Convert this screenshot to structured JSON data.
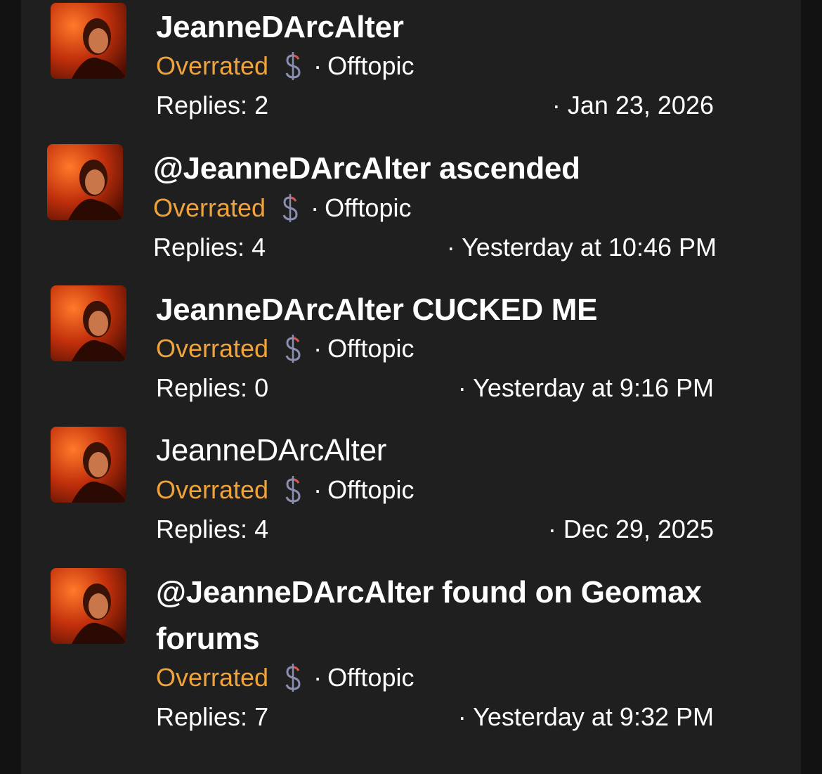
{
  "threads": [
    {
      "title": "JeanneDArcAlter",
      "prefix": "Overrated",
      "separator": "·",
      "forum": "Offtopic",
      "replies": "Replies: 2",
      "date": "· Jan 23, 2026"
    },
    {
      "title": "@JeanneDArcAlter ascended",
      "prefix": "Overrated",
      "separator": "·",
      "forum": "Offtopic",
      "replies": "Replies: 4",
      "date": "· Yesterday at 10:46 PM"
    },
    {
      "title": "JeanneDArcAlter CUCKED ME",
      "prefix": "Overrated",
      "separator": "·",
      "forum": "Offtopic",
      "replies": "Replies: 0",
      "date": "· Yesterday at 9:16 PM"
    },
    {
      "title": "JeanneDArcAlter",
      "prefix": "Overrated",
      "separator": "·",
      "forum": "Offtopic",
      "replies": "Replies: 4",
      "date": "· Dec 29, 2025"
    },
    {
      "title": "@JeanneDArcAlter found on Geomax forums",
      "prefix": "Overrated",
      "separator": "·",
      "forum": "Offtopic",
      "replies": "Replies: 7",
      "date": "· Yesterday at 9:32 PM"
    }
  ],
  "icons": {
    "prefix_icon": "dollar-sign-icon"
  },
  "colors": {
    "background": "#1f1f1f",
    "prefix": "#f0a33a",
    "text": "#ffffff"
  }
}
